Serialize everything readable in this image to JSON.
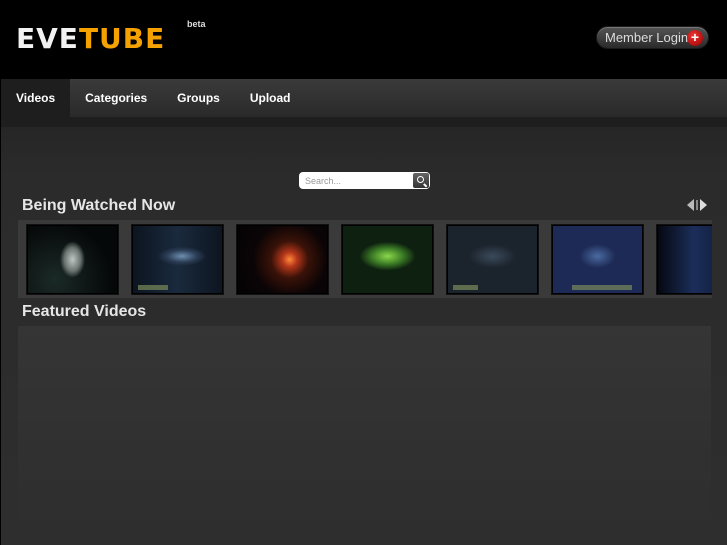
{
  "header": {
    "logo_part1": "EVE",
    "logo_part2": "TUBE",
    "beta_label": "beta",
    "member_login_label": "Member Login",
    "login_icon": "plus-icon"
  },
  "nav": {
    "items": [
      {
        "label": "Videos",
        "active": true
      },
      {
        "label": "Categories",
        "active": false
      },
      {
        "label": "Groups",
        "active": false
      },
      {
        "label": "Upload",
        "active": false
      }
    ]
  },
  "search": {
    "placeholder": "Search...",
    "button_icon": "search-icon"
  },
  "sections": {
    "being_watched_title": "Being Watched Now",
    "featured_title": "Featured Videos"
  },
  "carousel": {
    "prev_icon": "arrow-left-icon",
    "next_icon": "arrow-right-icon",
    "thumbnails": [
      "video-thumbnail-1",
      "video-thumbnail-2",
      "video-thumbnail-3",
      "video-thumbnail-4",
      "video-thumbnail-5",
      "video-thumbnail-6",
      "video-thumbnail-7"
    ]
  },
  "colors": {
    "accent": "#f5a200",
    "login_badge": "#cc1a1a",
    "background": "#000000",
    "panel": "#2e2e2e"
  }
}
